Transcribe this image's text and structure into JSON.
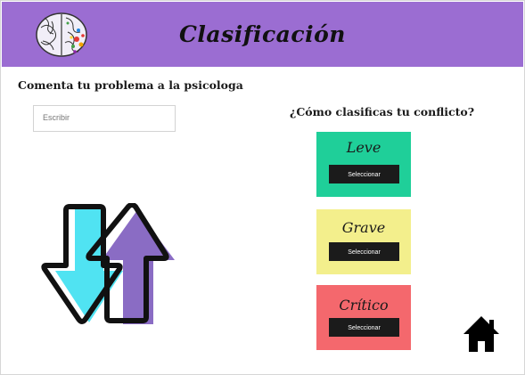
{
  "header": {
    "title": "Clasificación",
    "background_color": "#9b6dd2",
    "logo_icon": "brain-icon"
  },
  "left": {
    "prompt": "Comenta tu problema a la psicologa",
    "input": {
      "placeholder": "Escribir",
      "value": ""
    },
    "illustration_icon": "up-down-arrows-icon"
  },
  "right": {
    "question": "¿Cómo clasificas tu conflicto?",
    "cards": [
      {
        "label": "Leve",
        "button": "Seleccionar",
        "color": "#1fcf99"
      },
      {
        "label": "Grave",
        "button": "Seleccionar",
        "color": "#f3ef8c"
      },
      {
        "label": "Crítico",
        "button": "Seleccionar",
        "color": "#f4686d"
      }
    ]
  },
  "nav": {
    "home_icon": "home-icon"
  }
}
